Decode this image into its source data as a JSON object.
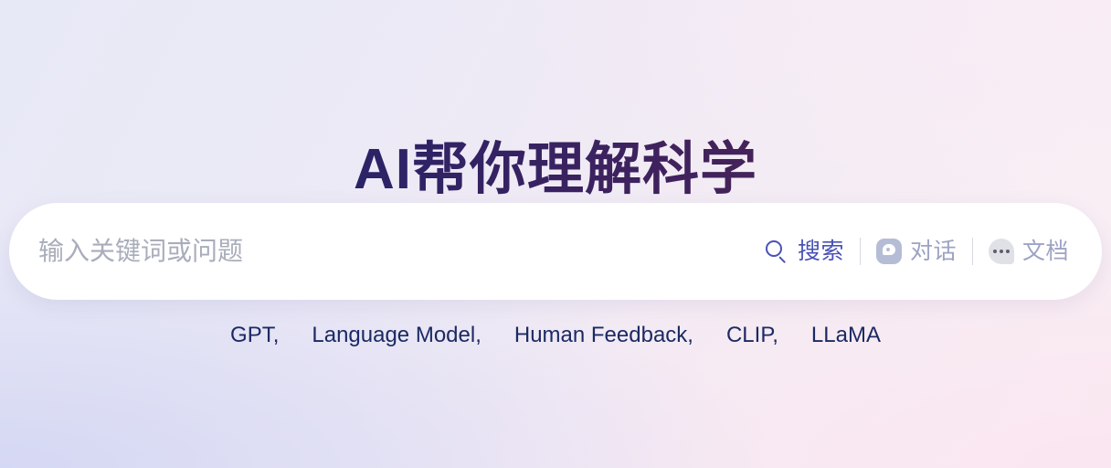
{
  "hero": {
    "title": "AI帮你理解科学"
  },
  "search": {
    "placeholder": "输入关键词或问题",
    "value": "",
    "actions": [
      {
        "label": "搜索",
        "icon": "search-icon",
        "state": "active"
      },
      {
        "label": "对话",
        "icon": "chat-bubble-icon",
        "state": "muted"
      },
      {
        "label": "文档",
        "icon": "ellipsis-bubble-icon",
        "state": "muted"
      }
    ]
  },
  "keywords": [
    {
      "label": "GPT,"
    },
    {
      "label": "Language Model,"
    },
    {
      "label": "Human Feedback,"
    },
    {
      "label": "CLIP,"
    },
    {
      "label": "LLaMA"
    }
  ],
  "colors": {
    "title_gradient_start": "#182863",
    "title_gradient_end": "#56234c",
    "active_action": "#4a52b5",
    "muted_action": "#9da3c3",
    "keyword": "#1b2a63",
    "placeholder": "#a9adbb",
    "bar_background": "#ffffff",
    "page_gradient_start": "#e8e9f7",
    "page_gradient_end": "#f9eef3"
  }
}
